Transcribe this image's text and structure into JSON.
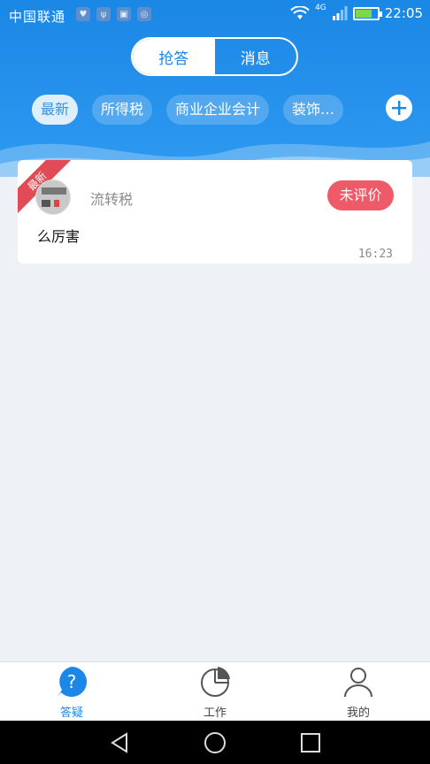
{
  "status_bar": {
    "carrier": "中国联通",
    "network": "4G",
    "time": "22:05"
  },
  "header": {
    "segments": [
      {
        "label": "抢答",
        "active": true
      },
      {
        "label": "消息",
        "active": false
      }
    ],
    "categories": [
      {
        "label": "最新",
        "active": true
      },
      {
        "label": "所得税",
        "active": false
      },
      {
        "label": "商业企业会计",
        "active": false
      },
      {
        "label": "装饰…",
        "active": false
      }
    ],
    "add_icon": "plus-icon"
  },
  "feed": [
    {
      "ribbon": "最新",
      "username": "流转税",
      "status": "未评价",
      "content": "么厉害",
      "time": "16:23"
    }
  ],
  "bottom_nav": [
    {
      "label": "答疑",
      "icon": "question-icon",
      "active": true
    },
    {
      "label": "工作",
      "icon": "pie-chart-icon",
      "active": false
    },
    {
      "label": "我的",
      "icon": "user-icon",
      "active": false
    }
  ],
  "colors": {
    "primary": "#1b87e6",
    "badge": "#ef5a68",
    "background": "#eef1f6"
  }
}
